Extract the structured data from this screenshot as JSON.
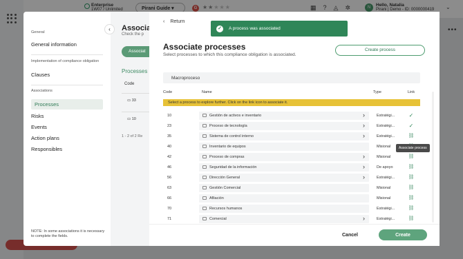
{
  "background": {
    "enterprise_name": "Enterprise",
    "enterprise_plan": "1W07 / Unlimited",
    "guide_label": "Pirani Guide",
    "guide_badge": "G",
    "user_greeting": "Hello, Natalia",
    "user_org": "Pirani | Demo - ID: 0000000419",
    "avatar_initial": "N",
    "stars_filled": 2,
    "stars_total": 5
  },
  "left_panel": {
    "sections": [
      {
        "title": "General",
        "items": [
          "General information"
        ]
      },
      {
        "title": "Implementation of compliance obligation",
        "items": [
          "Clauses"
        ]
      },
      {
        "title": "Associations",
        "items": [
          "Processes",
          "Risks",
          "Events",
          "Action plans",
          "Responsibles"
        ]
      }
    ],
    "active_item": "Processes",
    "note": "NOTE: In some associations it is necessary to complete the fields."
  },
  "middle_panel": {
    "title": "Associa",
    "subtitle": "Check the p",
    "button": "Associat",
    "tab": "Processes",
    "code_header": "Code",
    "rows": [
      "33",
      "10"
    ],
    "footer": "1 - 2 of 2 Re"
  },
  "dialog": {
    "return_label": "Return",
    "toast": "A process was associated",
    "title": "Associate processes",
    "subtitle": "Select processes to which this compliance obligation is associated.",
    "create_process_label": "Create process",
    "search_value": "Macroproceso",
    "columns": {
      "code": "Code",
      "name": "Name",
      "type": "Type",
      "link": "Link"
    },
    "banner": "Select a process to explore further. Click on the link icon to associate it.",
    "tooltip": "Associate process",
    "rows": [
      {
        "code": "10",
        "name": "Gestión de activos e inventario",
        "type": "Estratégi...",
        "has_children": true,
        "associated": true
      },
      {
        "code": "23",
        "name": "Proceso de tecnología",
        "type": "Estratégi...",
        "has_children": true,
        "associated": true
      },
      {
        "code": "35",
        "name": "Sistema de control interno",
        "type": "Estratégi...",
        "has_children": true,
        "associated": false
      },
      {
        "code": "40",
        "name": "Inventario de equipos",
        "type": "Misional",
        "has_children": false,
        "associated": false
      },
      {
        "code": "42",
        "name": "Proceso de compras",
        "type": "Misional",
        "has_children": true,
        "associated": false
      },
      {
        "code": "46",
        "name": "Seguridad de la información",
        "type": "De apoyo",
        "has_children": true,
        "associated": false
      },
      {
        "code": "56",
        "name": "Dirección General",
        "type": "Estratégi...",
        "has_children": true,
        "associated": false
      },
      {
        "code": "63",
        "name": "Gestión Comercial",
        "type": "Misional",
        "has_children": false,
        "associated": false
      },
      {
        "code": "66",
        "name": "Afliación",
        "type": "Misional",
        "has_children": false,
        "associated": false
      },
      {
        "code": "70",
        "name": "Recursos humanos",
        "type": "Estratégi...",
        "has_children": false,
        "associated": false
      },
      {
        "code": "71",
        "name": "Comercial",
        "type": "Estratégi...",
        "has_children": true,
        "associated": false
      }
    ],
    "cancel_label": "Cancel",
    "create_label": "Create"
  },
  "colors": {
    "brand_green": "#2f8658",
    "banner_yellow": "#e7c237",
    "button_green": "#5ea47d"
  }
}
